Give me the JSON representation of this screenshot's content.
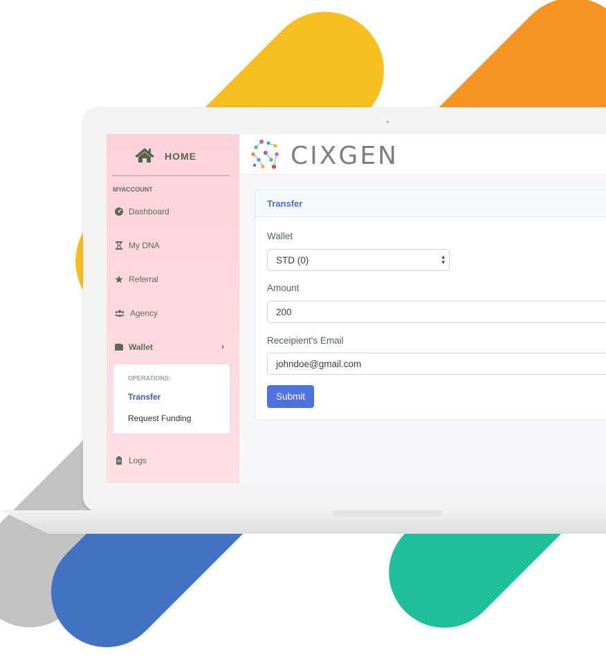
{
  "sidebar": {
    "home_label": "HOME",
    "section_label": "MYACCOUNT",
    "items": [
      {
        "label": "Dashboard",
        "icon": "tachometer-icon"
      },
      {
        "label": "My DNA",
        "icon": "hourglass-icon"
      },
      {
        "label": "Referral",
        "icon": "star-icon"
      },
      {
        "label": "Agency",
        "icon": "users-icon"
      },
      {
        "label": "Wallet",
        "icon": "wallet-icon"
      },
      {
        "label": "Logs",
        "icon": "clipboard-icon"
      }
    ],
    "submenu": {
      "heading": "OPERATIONS:",
      "items": [
        "Transfer",
        "Request Funding"
      ]
    }
  },
  "brand": {
    "name": "CIXGEN"
  },
  "form": {
    "title": "Transfer",
    "wallet_label": "Wallet",
    "wallet_value": "STD (0)",
    "amount_label": "Amount",
    "amount_value": "200",
    "email_label": "Receipient's Email",
    "email_value": "johndoe@gmail.com",
    "submit_label": "Submit"
  },
  "colors": {
    "sidebar_bg": "#fdd2dc",
    "accent": "#4e73df",
    "stripe_yellow": "#f6be1f",
    "stripe_orange": "#f59323",
    "stripe_gray": "#c2c2c2",
    "stripe_blue": "#4173c2",
    "stripe_green": "#1fbf9b"
  }
}
